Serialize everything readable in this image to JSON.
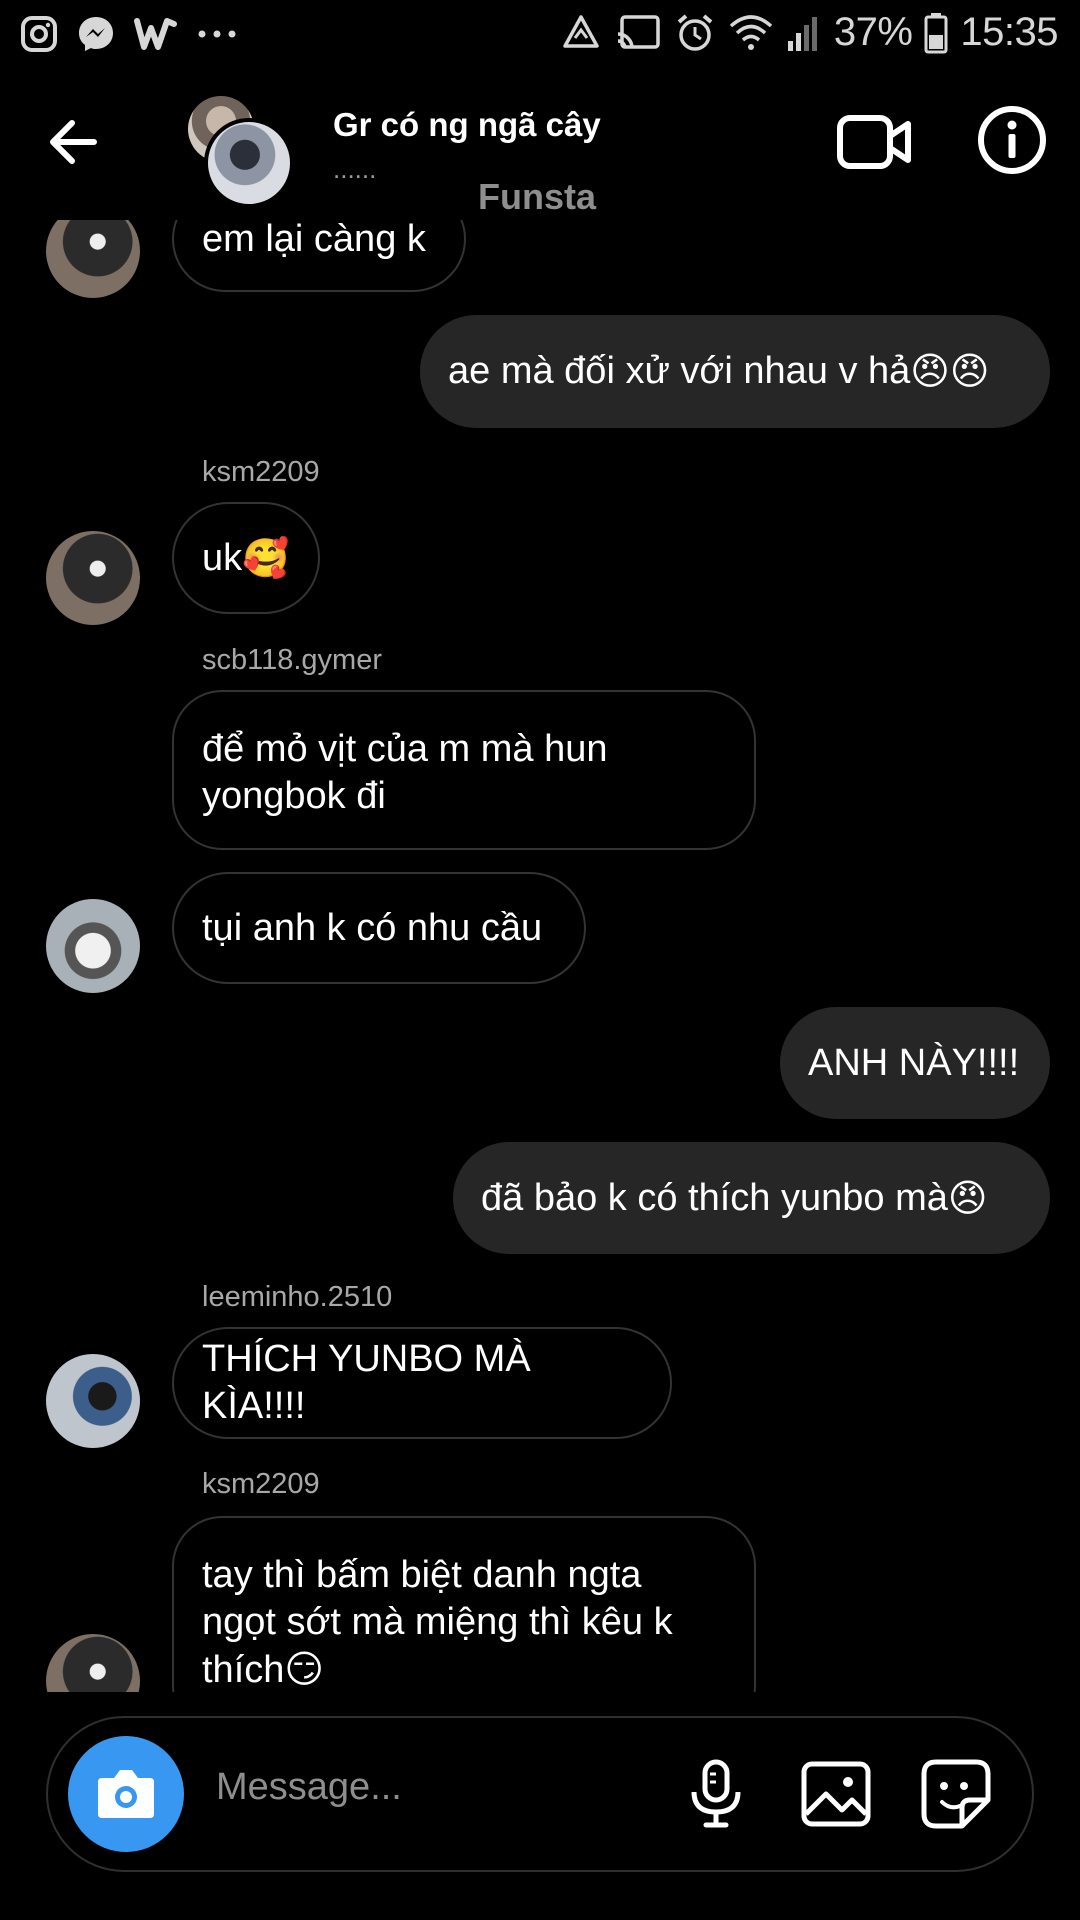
{
  "status_bar": {
    "battery": "37%",
    "time": "15:35",
    "icons": [
      "instagram-icon",
      "messenger-icon",
      "w-icon",
      "more-dots-icon",
      "sync-icon",
      "cast-icon",
      "alarm-icon",
      "wifi-icon",
      "signal-icon",
      "battery-icon"
    ]
  },
  "header": {
    "title": "Gr có ng ngã cây",
    "subtitle": "......",
    "nickname": "Funsta"
  },
  "messages": [
    {
      "direction": "in",
      "text": "em lại càng k"
    },
    {
      "direction": "out",
      "text": "ae mà đối xử với nhau v hả",
      "emoji": "😠😠"
    },
    {
      "direction": "in",
      "sender": "ksm2209",
      "text": "uk",
      "emoji": "🥰"
    },
    {
      "direction": "in",
      "sender": "scb118.gymer",
      "lines": [
        "để mỏ vịt của m mà hun",
        "yongbok đi"
      ]
    },
    {
      "direction": "in",
      "text": "tụi anh k có nhu cầu"
    },
    {
      "direction": "out",
      "text": "ANH NÀY!!!!"
    },
    {
      "direction": "out",
      "text": "đã bảo k có thích yunbo mà",
      "emoji": "😠"
    },
    {
      "direction": "in",
      "sender": "leeminho.2510",
      "text": "THÍCH YUNBO MÀ KÌA!!!!"
    },
    {
      "direction": "in",
      "sender": "ksm2209",
      "lines": [
        "tay thì bấm biệt danh ngta",
        "ngọt sớt mà miệng thì kêu k",
        "thích"
      ],
      "emoji": "😏"
    }
  ],
  "composer": {
    "placeholder": "Message..."
  },
  "colors": {
    "background": "#000000",
    "outgoing_bubble": "#262626",
    "incoming_border": "#333333",
    "camera_button": "#3897f0",
    "muted_text": "#a8a8a8"
  }
}
